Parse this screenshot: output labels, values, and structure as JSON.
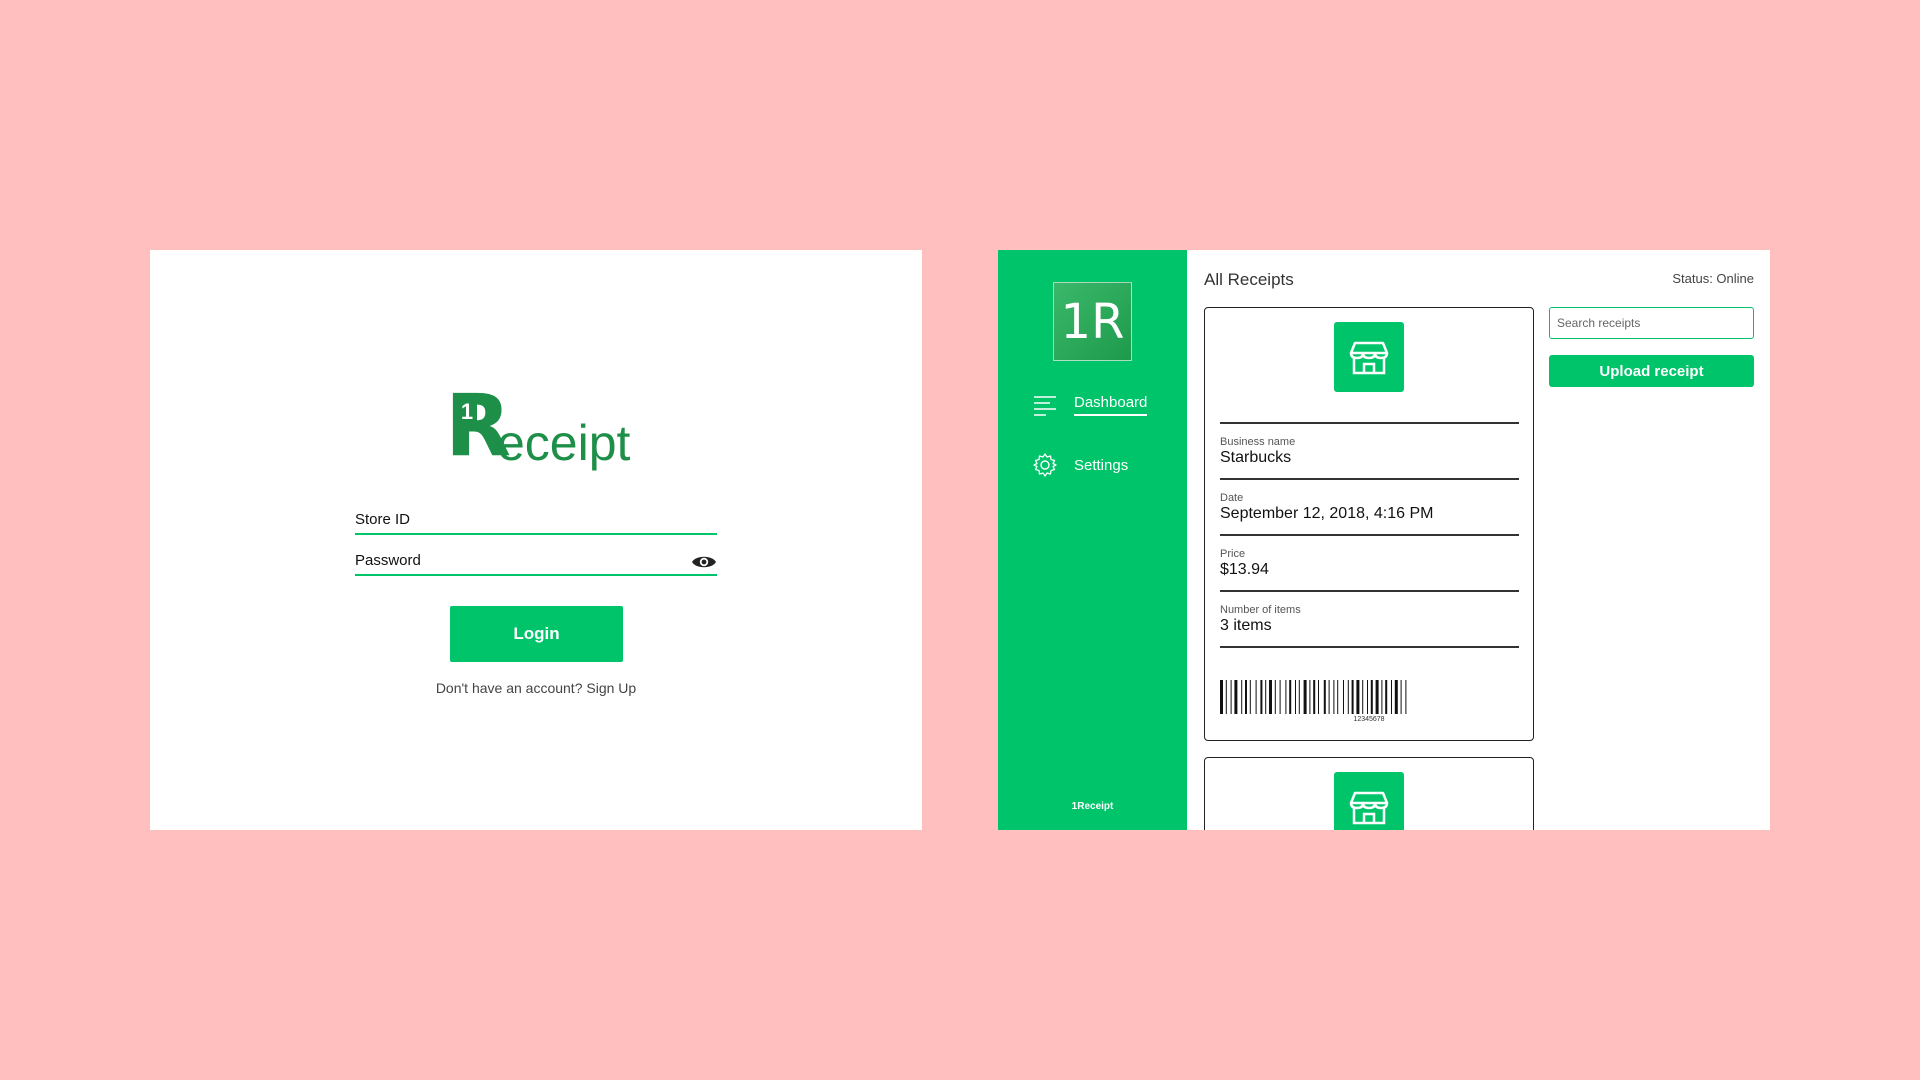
{
  "login": {
    "logo": {
      "number": "1",
      "letter": "R",
      "rest": "eceipt"
    },
    "store_id_label": "Store ID",
    "password_label": "Password",
    "login_button": "Login",
    "signup_text": "Don't have an account? Sign Up"
  },
  "dashboard": {
    "sidebar": {
      "logo_text": "1R",
      "items": [
        {
          "label": "Dashboard",
          "icon": "menu-lines-icon",
          "active": true
        },
        {
          "label": "Settings",
          "icon": "gear-icon",
          "active": false
        }
      ],
      "footer": "1Receipt"
    },
    "title": "All Receipts",
    "status": "Status: Online",
    "search": {
      "placeholder": "Search receipts"
    },
    "upload_button": "Upload receipt",
    "receipts": [
      {
        "icon": "store-icon",
        "business_label": "Business name",
        "business_value": "Starbucks",
        "date_label": "Date",
        "date_value": "September 12, 2018, 4:16 PM",
        "price_label": "Price",
        "price_value": "$13.94",
        "items_label": "Number of items",
        "items_value": "3 items",
        "barcode_number": "12345678"
      }
    ]
  },
  "colors": {
    "background": "#ffbfbf",
    "accent": "#00c46a",
    "logo_green": "#1e8f48"
  }
}
